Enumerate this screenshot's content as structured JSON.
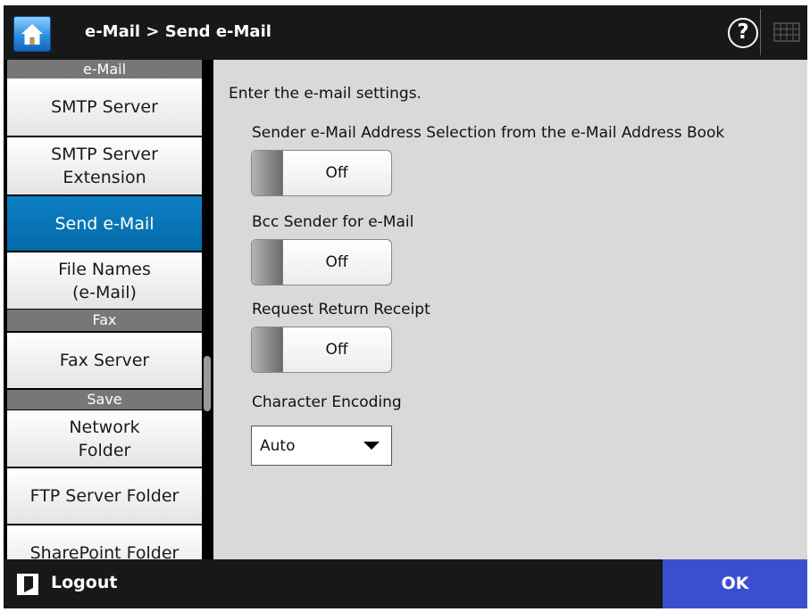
{
  "header": {
    "breadcrumb": "e-Mail > Send e-Mail",
    "help_symbol": "?",
    "icons": [
      "home-icon",
      "help-icon",
      "keyboard-icon"
    ]
  },
  "sidebar": {
    "sections": [
      {
        "title": "e-Mail"
      },
      {
        "title": "Fax"
      },
      {
        "title": "Save"
      }
    ],
    "items": [
      {
        "label": "SMTP Server",
        "active": false
      },
      {
        "label": "SMTP Server\nExtension",
        "active": false
      },
      {
        "label": "Send e-Mail",
        "active": true
      },
      {
        "label": "File Names\n(e-Mail)",
        "active": false
      },
      {
        "label": "Fax Server",
        "active": false
      },
      {
        "label": "Network\nFolder",
        "active": false
      },
      {
        "label": "FTP Server Folder",
        "active": false
      },
      {
        "label": "SharePoint Folder",
        "active": false
      }
    ]
  },
  "main": {
    "instruction": "Enter the e-mail settings.",
    "settings": [
      {
        "label": "Sender e-Mail Address Selection from the e-Mail Address Book",
        "value": "Off"
      },
      {
        "label": "Bcc Sender for e-Mail",
        "value": "Off"
      },
      {
        "label": "Request Return Receipt",
        "value": "Off"
      }
    ],
    "encoding": {
      "label": "Character Encoding",
      "value": "Auto"
    }
  },
  "footer": {
    "logout_label": "Logout",
    "ok_label": "OK"
  },
  "colors": {
    "active_item": "#0878bb",
    "ok_button": "#3a4fd0",
    "header_bg": "#181818",
    "content_bg": "#d9d9d9"
  }
}
